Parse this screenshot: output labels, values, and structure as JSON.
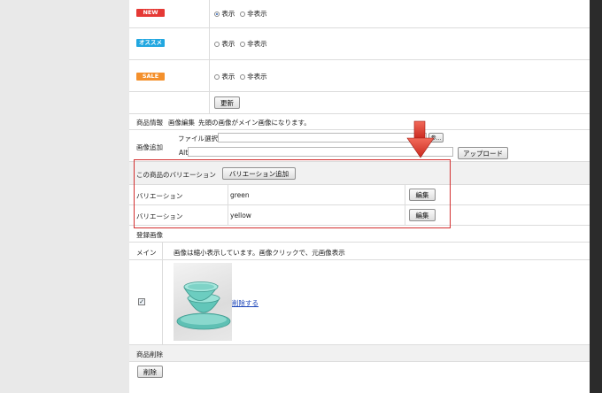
{
  "badges": [
    {
      "text": "NEW",
      "color": "#e53935"
    },
    {
      "text": "オススメ",
      "color": "#22a7e0"
    },
    {
      "text": "SALE",
      "color": "#f4902c"
    }
  ],
  "radio": {
    "show": "表示",
    "hide": "非表示"
  },
  "update_button": "更新",
  "product_info": {
    "label": "商品情報",
    "image_edit": "画像編集",
    "note": "先頭の画像がメイン画像になります。"
  },
  "image_add": {
    "label": "画像追加",
    "file_label": "ファイル選択",
    "browse_label": "参...",
    "alt_label": "Alt",
    "upload_button": "アップロード"
  },
  "variation": {
    "header": "この商品のバリエーション",
    "add_button": "バリエーション追加",
    "rows": [
      {
        "label": "バリエーション",
        "value": "green",
        "edit": "編集"
      },
      {
        "label": "バリエーション",
        "value": "yellow",
        "edit": "編集"
      }
    ]
  },
  "registered_images": {
    "label": "登録画像",
    "main_label": "メイン",
    "note": "画像は縮小表示しています。画像クリックで、元画像表示",
    "checked": true,
    "delete_link": "削除する"
  },
  "product_delete": {
    "label": "商品削除",
    "button": "削除"
  },
  "colors": {
    "highlight": "#d32f2f",
    "link": "#1a44b8"
  }
}
